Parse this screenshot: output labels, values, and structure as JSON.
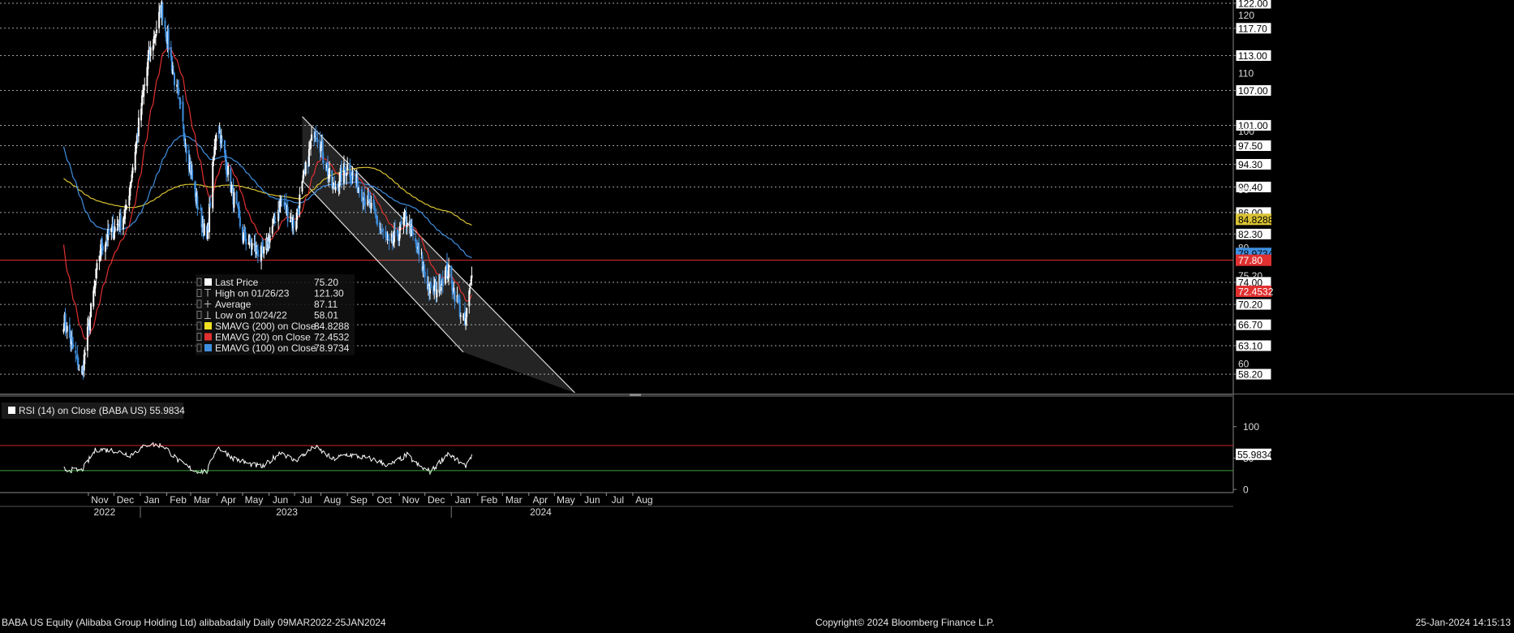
{
  "colors": {
    "background": "#000000",
    "candle_up": "#ffffff",
    "candle_down": "#3f8fe0",
    "sma200": "#d9c233",
    "ema20": "#e03030",
    "ema100": "#3f8fe0",
    "grid": "#bdbdbd",
    "channel": "#dddddd",
    "rsi_line": "#ffffff",
    "rsi_upper": "#cc2222",
    "rsi_lower": "#3aa03a",
    "axis_label_bg": "#ffffff",
    "axis_label_fg": "#000000"
  },
  "chart_data": [
    {
      "type": "candlestick",
      "symbol": "BABA US",
      "ylim": [
        55,
        122
      ],
      "y_axis_boxed_labels": [
        "122.00",
        "117.70",
        "113.00",
        "107.00",
        "101.00",
        "97.50",
        "94.30",
        "90.40",
        "86.00",
        "82.30",
        "74.00",
        "70.20",
        "66.70",
        "63.10",
        "58.20"
      ],
      "y_axis_plain_labels": [
        "120",
        "110",
        "100",
        "90",
        "80",
        "75.20",
        "60"
      ],
      "price_markers": [
        {
          "label": "84.8288",
          "value": 84.8288,
          "bg": "#d9c233",
          "fg": "#000000"
        },
        {
          "label": "78.9734",
          "value": 78.9734,
          "bg": "#3f8fe0",
          "fg": "#000000"
        },
        {
          "label": "77.80",
          "value": 77.8,
          "bg": "#e03030",
          "fg": "#ffffff"
        },
        {
          "label": "72.4532",
          "value": 72.4532,
          "bg": "#e03030",
          "fg": "#ffffff"
        }
      ],
      "horizontal_lines": [
        {
          "value": 77.8,
          "color": "#e03030"
        }
      ],
      "channel": {
        "upper": {
          "from": [
            "2023-07-10",
            102.5
          ],
          "to": [
            "2024-05-25",
            55.0
          ]
        },
        "lower": {
          "from": [
            "2023-07-10",
            91.5
          ],
          "to": [
            "2024-01-15",
            62.0
          ]
        }
      },
      "legend": [
        {
          "label": "Last Price",
          "value": "75.20",
          "swatch": "#ffffff",
          "marker": "square"
        },
        {
          "label": "High on 01/26/23",
          "value": "121.30",
          "marker": "high"
        },
        {
          "label": "Average",
          "value": "87.11",
          "marker": "avg"
        },
        {
          "label": "Low on 10/24/22",
          "value": "58.01",
          "marker": "low"
        },
        {
          "label": "SMAVG (200)  on Close",
          "value": "84.8288",
          "swatch": "#f0e020",
          "marker": "square"
        },
        {
          "label": "EMAVG (20)  on Close",
          "value": "72.4532",
          "swatch": "#e03030",
          "marker": "square"
        },
        {
          "label": "EMAVG (100)  on Close",
          "value": "78.9734",
          "swatch": "#3f8fe0",
          "marker": "square"
        }
      ],
      "key_points": [
        {
          "date": "2022-10-01",
          "close": 68.5
        },
        {
          "date": "2022-10-24",
          "close": 58.01
        },
        {
          "date": "2022-11-15",
          "close": 80.0
        },
        {
          "date": "2022-12-15",
          "close": 86.0
        },
        {
          "date": "2023-01-10",
          "close": 112.0
        },
        {
          "date": "2023-01-26",
          "close": 121.3
        },
        {
          "date": "2023-02-15",
          "close": 105.0
        },
        {
          "date": "2023-03-05",
          "close": 90.0
        },
        {
          "date": "2023-03-20",
          "close": 81.0
        },
        {
          "date": "2023-04-01",
          "close": 102.0
        },
        {
          "date": "2023-04-15",
          "close": 92.0
        },
        {
          "date": "2023-05-01",
          "close": 82.0
        },
        {
          "date": "2023-05-25",
          "close": 78.5
        },
        {
          "date": "2023-06-15",
          "close": 88.0
        },
        {
          "date": "2023-07-01",
          "close": 84.0
        },
        {
          "date": "2023-07-25",
          "close": 101.0
        },
        {
          "date": "2023-08-15",
          "close": 90.0
        },
        {
          "date": "2023-09-01",
          "close": 94.0
        },
        {
          "date": "2023-10-01",
          "close": 86.0
        },
        {
          "date": "2023-10-20",
          "close": 80.0
        },
        {
          "date": "2023-11-10",
          "close": 85.0
        },
        {
          "date": "2023-11-25",
          "close": 78.0
        },
        {
          "date": "2023-12-08",
          "close": 72.0
        },
        {
          "date": "2023-12-28",
          "close": 76.0
        },
        {
          "date": "2024-01-17",
          "close": 66.5
        },
        {
          "date": "2024-01-25",
          "close": 75.2
        }
      ]
    },
    {
      "type": "line",
      "title": "RSI (14)  on Close (BABA US) 55.9834",
      "ylim": [
        -5,
        110
      ],
      "y_axis_plain_labels": [
        "100",
        "50",
        "0"
      ],
      "upper_level": 70,
      "lower_level": 30,
      "last_value_label": "55.9834",
      "points": [
        {
          "date": "2022-10-01",
          "rsi": 32
        },
        {
          "date": "2022-10-24",
          "rsi": 30
        },
        {
          "date": "2022-11-10",
          "rsi": 64
        },
        {
          "date": "2022-12-01",
          "rsi": 62
        },
        {
          "date": "2022-12-20",
          "rsi": 55
        },
        {
          "date": "2023-01-10",
          "rsi": 72
        },
        {
          "date": "2023-01-28",
          "rsi": 70
        },
        {
          "date": "2023-02-15",
          "rsi": 45
        },
        {
          "date": "2023-03-05",
          "rsi": 30
        },
        {
          "date": "2023-03-20",
          "rsi": 28
        },
        {
          "date": "2023-04-01",
          "rsi": 68
        },
        {
          "date": "2023-04-20",
          "rsi": 50
        },
        {
          "date": "2023-05-10",
          "rsi": 40
        },
        {
          "date": "2023-05-25",
          "rsi": 36
        },
        {
          "date": "2023-06-15",
          "rsi": 60
        },
        {
          "date": "2023-07-01",
          "rsi": 45
        },
        {
          "date": "2023-07-25",
          "rsi": 68
        },
        {
          "date": "2023-08-15",
          "rsi": 48
        },
        {
          "date": "2023-09-01",
          "rsi": 56
        },
        {
          "date": "2023-10-01",
          "rsi": 48
        },
        {
          "date": "2023-10-20",
          "rsi": 38
        },
        {
          "date": "2023-11-10",
          "rsi": 55
        },
        {
          "date": "2023-11-25",
          "rsi": 36
        },
        {
          "date": "2023-12-08",
          "rsi": 28
        },
        {
          "date": "2023-12-28",
          "rsi": 58
        },
        {
          "date": "2024-01-17",
          "rsi": 36
        },
        {
          "date": "2024-01-25",
          "rsi": 55.9834
        }
      ]
    }
  ],
  "x_axis": {
    "months": [
      {
        "label": "Nov",
        "date": "2022-11-01"
      },
      {
        "label": "Dec",
        "date": "2022-12-01"
      },
      {
        "label": "Jan",
        "date": "2023-01-01"
      },
      {
        "label": "Feb",
        "date": "2023-02-01"
      },
      {
        "label": "Mar",
        "date": "2023-03-01"
      },
      {
        "label": "Apr",
        "date": "2023-04-01"
      },
      {
        "label": "May",
        "date": "2023-05-01"
      },
      {
        "label": "Jun",
        "date": "2023-06-01"
      },
      {
        "label": "Jul",
        "date": "2023-07-01"
      },
      {
        "label": "Aug",
        "date": "2023-08-01"
      },
      {
        "label": "Sep",
        "date": "2023-09-01"
      },
      {
        "label": "Oct",
        "date": "2023-10-01"
      },
      {
        "label": "Nov",
        "date": "2023-11-01"
      },
      {
        "label": "Dec",
        "date": "2023-12-01"
      },
      {
        "label": "Jan",
        "date": "2024-01-01"
      },
      {
        "label": "Feb",
        "date": "2024-02-01"
      },
      {
        "label": "Mar",
        "date": "2024-03-01"
      },
      {
        "label": "Apr",
        "date": "2024-04-01"
      },
      {
        "label": "May",
        "date": "2024-05-01"
      },
      {
        "label": "Jun",
        "date": "2024-06-01"
      },
      {
        "label": "Jul",
        "date": "2024-07-01"
      },
      {
        "label": "Aug",
        "date": "2024-08-01"
      }
    ],
    "years": [
      {
        "label": "2022",
        "date": "2022-11-20"
      },
      {
        "label": "2023",
        "date": "2023-06-22"
      },
      {
        "label": "2024",
        "date": "2024-04-15"
      }
    ]
  },
  "footer": {
    "left": "BABA US Equity (Alibaba Group Holding Ltd) alibabadaily  Daily 09MAR2022-25JAN2024",
    "center": "Copyright© 2024 Bloomberg Finance L.P.",
    "right": "25-Jan-2024 14:15:13"
  }
}
